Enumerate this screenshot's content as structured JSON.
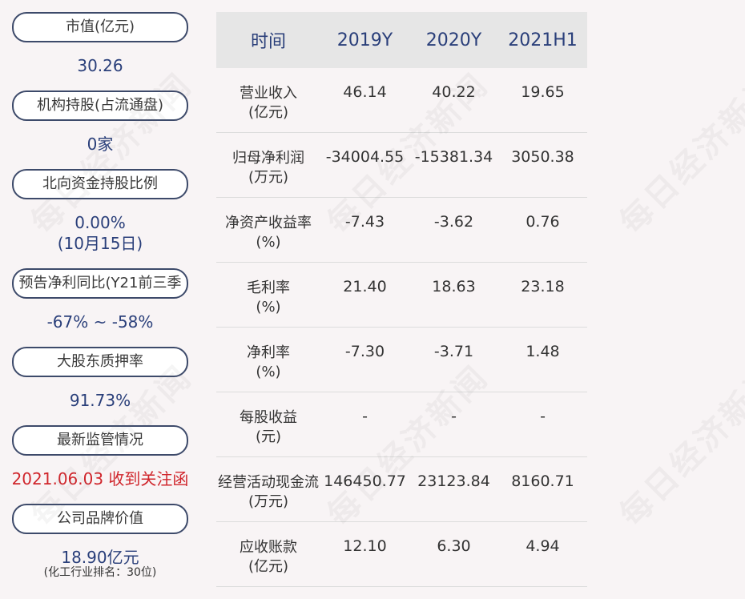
{
  "watermark": "每日经济新闻",
  "left": {
    "market_cap_label": "市值(亿元)",
    "market_cap_value": "30.26",
    "institution_label": "机构持股(占流通盘)",
    "institution_value": "0家",
    "northbound_label": "北向资金持股比例",
    "northbound_value": "0.00%",
    "northbound_date": "(10月15日)",
    "forecast_label": "预告净利同比(Y21前三季",
    "forecast_value": "-67% ~ -58%",
    "pledge_label": "大股东质押率",
    "pledge_value": "91.73%",
    "regulation_label": "最新监管情况",
    "regulation_value": "2021.06.03 收到关注函",
    "brand_label": "公司品牌价值",
    "brand_value": "18.90亿元",
    "brand_rank": "(化工行业排名：30位)"
  },
  "table": {
    "headers": [
      "时间",
      "2019Y",
      "2020Y",
      "2021H1"
    ],
    "rows": [
      {
        "label1": "营业收入",
        "label2": "(亿元)",
        "values": [
          "46.14",
          "40.22",
          "19.65"
        ]
      },
      {
        "label1": "归母净利润",
        "label2": "(万元)",
        "values": [
          "-34004.55",
          "-15381.34",
          "3050.38"
        ]
      },
      {
        "label1": "净资产收益率",
        "label2": "(%)",
        "values": [
          "-7.43",
          "-3.62",
          "0.76"
        ]
      },
      {
        "label1": "毛利率",
        "label2": "(%)",
        "values": [
          "21.40",
          "18.63",
          "23.18"
        ]
      },
      {
        "label1": "净利率",
        "label2": "(%)",
        "values": [
          "-7.30",
          "-3.71",
          "1.48"
        ]
      },
      {
        "label1": "每股收益",
        "label2": "(元)",
        "values": [
          "-",
          "-",
          "-"
        ]
      },
      {
        "label1": "经营活动现金流",
        "label2": "(万元)",
        "values": [
          "146450.77",
          "23123.84",
          "8160.71"
        ]
      },
      {
        "label1": "应收账款",
        "label2": "(亿元)",
        "values": [
          "12.10",
          "6.30",
          "4.94"
        ]
      }
    ]
  },
  "colors": {
    "background": "#f8f4f5",
    "value_blue": "#2a3f7a",
    "alert_red": "#d0262c",
    "pill_border": "#3d4a6a",
    "header_bg": "#e6e6e6"
  }
}
